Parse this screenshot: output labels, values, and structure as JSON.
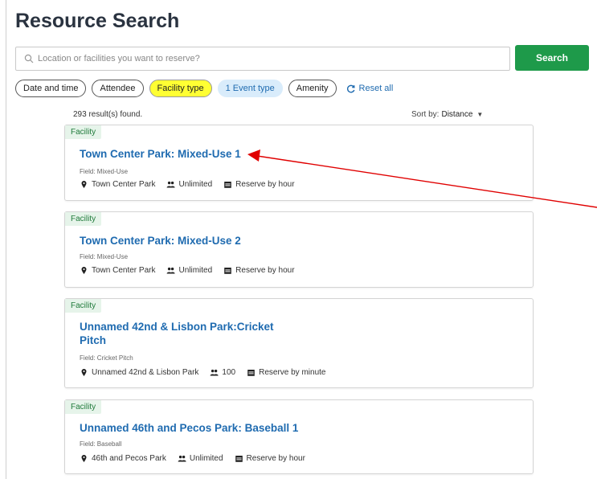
{
  "page": {
    "title": "Resource Search"
  },
  "search": {
    "placeholder": "Location or facilities you want to reserve?",
    "button_label": "Search"
  },
  "filters": [
    {
      "label": "Date and time",
      "state": "default"
    },
    {
      "label": "Attendee",
      "state": "default"
    },
    {
      "label": "Facility type",
      "state": "highlight"
    },
    {
      "label": "1 Event type",
      "state": "active"
    },
    {
      "label": "Amenity",
      "state": "default"
    }
  ],
  "reset_label": "Reset all",
  "results": {
    "count_text": "293 result(s) found.",
    "sort_label": "Sort by:",
    "sort_value": "Distance"
  },
  "cards": [
    {
      "badge": "Facility",
      "title_lines": [
        "Town Center Park: Mixed-Use 1"
      ],
      "field": "Field: Mixed-Use",
      "location": "Town Center Park",
      "capacity": "Unlimited",
      "reserve": "Reserve by hour"
    },
    {
      "badge": "Facility",
      "title_lines": [
        "Town Center Park: Mixed-Use 2"
      ],
      "field": "Field: Mixed-Use",
      "location": "Town Center Park",
      "capacity": "Unlimited",
      "reserve": "Reserve by hour"
    },
    {
      "badge": "Facility",
      "title_lines": [
        "Unnamed 42nd & Lisbon Park:Cricket",
        "Pitch"
      ],
      "field": "Field: Cricket Pitch",
      "location": "Unnamed 42nd & Lisbon Park",
      "capacity": "100",
      "reserve": "Reserve by minute"
    },
    {
      "badge": "Facility",
      "title_lines": [
        "Unnamed 46th and Pecos Park: Baseball 1"
      ],
      "field": "Field: Baseball",
      "location": "46th and Pecos Park",
      "capacity": "Unlimited",
      "reserve": "Reserve by hour"
    }
  ],
  "colors": {
    "accent": "#1e9a4a",
    "link": "#1f6bb0",
    "highlight": "#ffff33",
    "annotation_arrow": "#e00000"
  }
}
